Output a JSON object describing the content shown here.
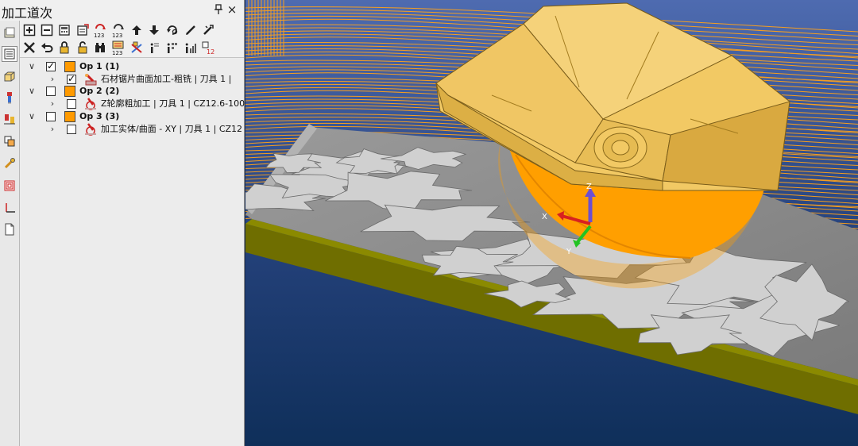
{
  "panel": {
    "title": "加工道次",
    "pin_icon": "pin-icon",
    "close_glyph": "×"
  },
  "side_icons": [
    "folder-icon",
    "operations-icon",
    "stock-icon",
    "tool-icon",
    "toolpath-icon",
    "layers-icon",
    "tool-library-icon",
    "pattern-icon",
    "axis-icon",
    "document-icon"
  ],
  "toolbar": {
    "row1": [
      "expand-icon",
      "collapse-icon",
      "calculate-icon",
      "regenerate-icon",
      "simulate-icon",
      "renumber-icon",
      "move-up-icon",
      "move-down-icon",
      "refresh-icon",
      "edit-icon",
      "tools-icon"
    ],
    "row2": [
      "delete-icon",
      "undo-icon",
      "lock-icon",
      "unlock-icon",
      "find-icon",
      "sort-icon",
      "tool-change-icon",
      "info-icon",
      "info-list-icon",
      "info-stats-icon",
      "number-icon"
    ],
    "renumber_text": "123",
    "number_text": "12"
  },
  "tree": {
    "ops": [
      {
        "label": "Op 1 (1)",
        "checked": true,
        "job": {
          "label": "石材锯片曲面加工-粗铣 | 刀具 1 | ",
          "checked": true
        }
      },
      {
        "label": "Op 2 (2)",
        "checked": false,
        "job": {
          "label": "Z轮廓粗加工 | 刀具 1 | CZ12.6-100",
          "checked": false
        }
      },
      {
        "label": "Op 3 (3)",
        "checked": false,
        "job": {
          "label": "加工实体/曲面 - XY | 刀具 1 | CZ12",
          "checked": false
        }
      }
    ]
  },
  "viewport": {
    "axis_x": "X",
    "axis_y": "Y",
    "axis_z": "Z",
    "colors": {
      "background_top": "#4e6bb0",
      "background_bottom": "#0f2f5a",
      "toolpath": "#ffa21a",
      "blade": "#f2c964",
      "blade_disc": "#ff9f00",
      "stone": "#8d8d8d",
      "base_plate": "#8b8a00"
    }
  }
}
